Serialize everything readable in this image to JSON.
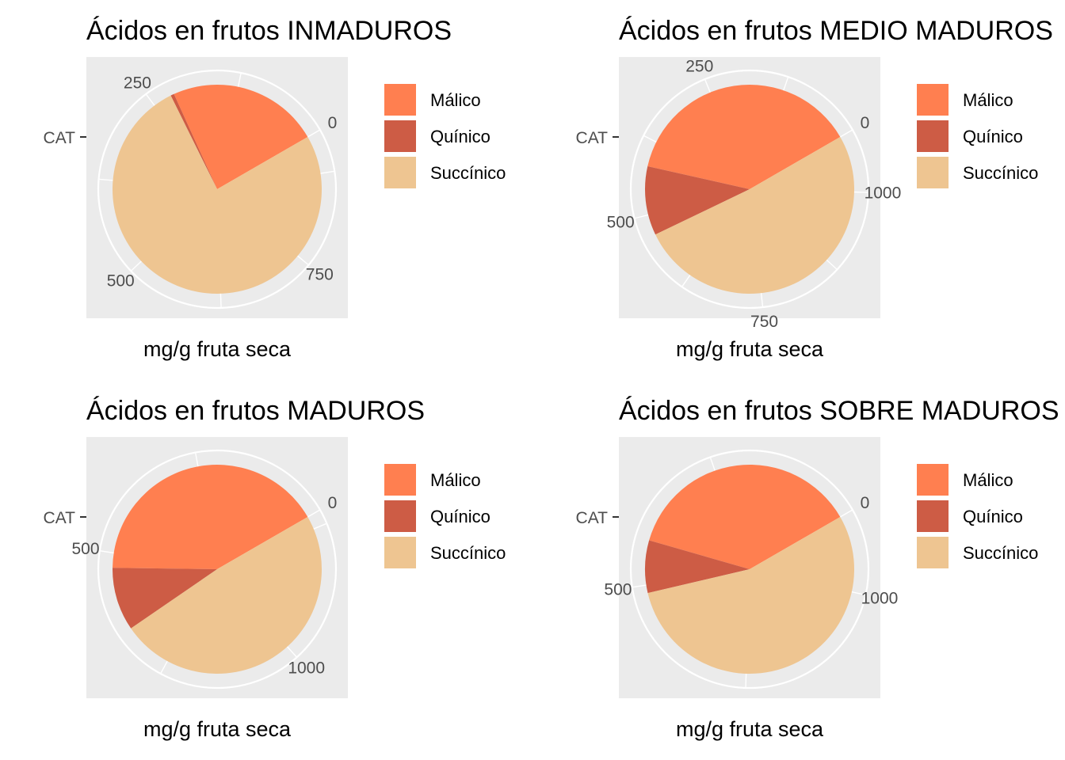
{
  "chart_data": [
    {
      "type": "pie",
      "title": "Ácidos en frutos INMADUROS",
      "xlabel": "mg/g fruta seca",
      "ylabel": "",
      "y_category": "CAT",
      "legend_position": "right",
      "categories": [
        "Málico",
        "Quínico",
        "Succínico"
      ],
      "values": [
        218,
        5,
        707
      ],
      "axis_ticks": [
        0,
        250,
        500,
        750
      ],
      "axis_max": 930
    },
    {
      "type": "pie",
      "title": "Ácidos en frutos MEDIO MADUROS",
      "xlabel": "mg/g fruta seca",
      "ylabel": "",
      "y_category": "CAT",
      "legend_position": "right",
      "categories": [
        "Málico",
        "Quínico",
        "Succínico"
      ],
      "values": [
        418,
        117,
        561
      ],
      "axis_ticks": [
        0,
        250,
        500,
        750,
        1000
      ],
      "axis_max": 1096
    },
    {
      "type": "pie",
      "title": "Ácidos en frutos MADUROS",
      "xlabel": "mg/g fruta seca",
      "ylabel": "",
      "y_category": "CAT",
      "legend_position": "right",
      "categories": [
        "Málico",
        "Quínico",
        "Succínico"
      ],
      "values": [
        529,
        125,
        622
      ],
      "axis_ticks": [
        0,
        500,
        1000
      ],
      "axis_max": 1276
    },
    {
      "type": "pie",
      "title": "Ácidos en frutos SOBRE MADUROS",
      "xlabel": "mg/g fruta seca",
      "ylabel": "",
      "y_category": "CAT",
      "legend_position": "right",
      "categories": [
        "Málico",
        "Quínico",
        "Succínico"
      ],
      "values": [
        422,
        92,
        620
      ],
      "axis_ticks": [
        0,
        500,
        1000
      ],
      "axis_max": 1134
    }
  ],
  "colors": {
    "Málico": "#FF7F50",
    "Quínico": "#CD5C45",
    "Succínico": "#EEC591",
    "panel_background": "#EBEBEB",
    "grid": "#FFFFFF"
  }
}
